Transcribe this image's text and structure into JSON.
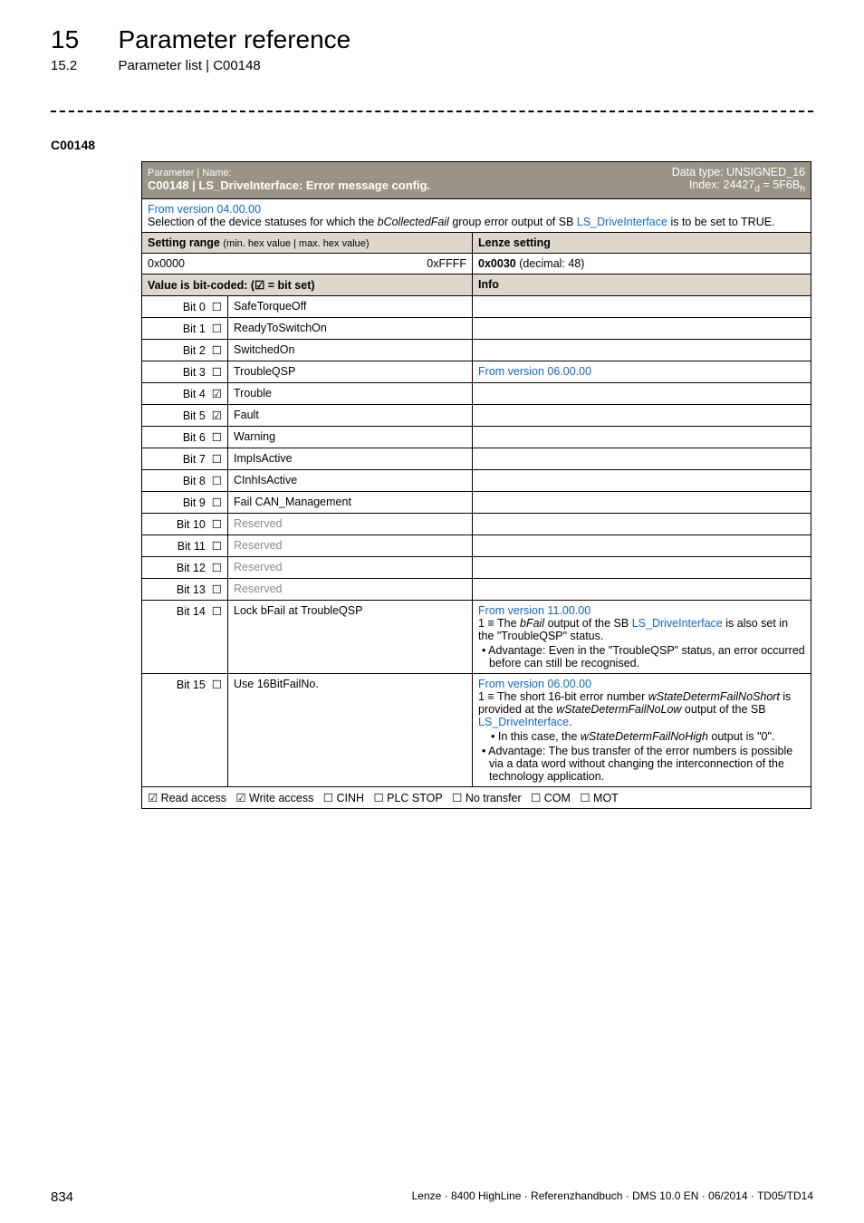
{
  "header": {
    "chapter_num": "15",
    "chapter_title": "Parameter reference",
    "section_num": "15.2",
    "section_title": "Parameter list | C00148"
  },
  "param_code": "C00148",
  "table": {
    "hdr_paramname_label": "Parameter | Name:",
    "hdr_paramname_value": "C00148 | LS_DriveInterface: Error message config.",
    "hdr_dtype": "Data type: UNSIGNED_16",
    "hdr_index": "Index: 24427",
    "hdr_index_d": "d",
    "hdr_index_eq": " = 5F6B",
    "hdr_index_h": "h",
    "desc_version": "From version 04.00.00",
    "desc_text_pre": "Selection of the device statuses for which the ",
    "desc_text_ital": "bCollectedFail",
    "desc_text_mid": " group error output of SB ",
    "desc_text_link": "LS_DriveInterface",
    "desc_text_post": " is to be set to TRUE.",
    "setting_range_label": "Setting range ",
    "setting_range_sub": "(min. hex value | max. hex value)",
    "lenze_setting_label": "Lenze setting",
    "min_hex": "0x0000",
    "max_hex": "0xFFFF",
    "default_hex": "0x0030",
    "default_dec": "  (decimal: 48)",
    "bitcoded_label_pre": "Value is bit-coded:  (",
    "bitcoded_label_post": " = bit set)",
    "info_label": "Info",
    "bits": [
      {
        "bit": "Bit 0",
        "chk": "☐",
        "name": "SafeTorqueOff",
        "info": ""
      },
      {
        "bit": "Bit 1",
        "chk": "☐",
        "name": "ReadyToSwitchOn",
        "info": ""
      },
      {
        "bit": "Bit 2",
        "chk": "☐",
        "name": "SwitchedOn",
        "info": ""
      },
      {
        "bit": "Bit 3",
        "chk": "☐",
        "name": "TroubleQSP",
        "info_link": "From version 06.00.00"
      },
      {
        "bit": "Bit 4",
        "chk": "☑",
        "name": "Trouble",
        "info": ""
      },
      {
        "bit": "Bit 5",
        "chk": "☑",
        "name": "Fault",
        "info": ""
      },
      {
        "bit": "Bit 6",
        "chk": "☐",
        "name": "Warning",
        "info": ""
      },
      {
        "bit": "Bit 7",
        "chk": "☐",
        "name": "ImpIsActive",
        "info": ""
      },
      {
        "bit": "Bit 8",
        "chk": "☐",
        "name": "CInhIsActive",
        "info": ""
      },
      {
        "bit": "Bit 9",
        "chk": "☐",
        "name": "Fail CAN_Management",
        "info": ""
      },
      {
        "bit": "Bit 10",
        "chk": "☐",
        "name": "Reserved",
        "grey": true,
        "info": ""
      },
      {
        "bit": "Bit 11",
        "chk": "☐",
        "name": "Reserved",
        "grey": true,
        "info": ""
      },
      {
        "bit": "Bit 12",
        "chk": "☐",
        "name": "Reserved",
        "grey": true,
        "info": ""
      },
      {
        "bit": "Bit 13",
        "chk": "☐",
        "name": "Reserved",
        "grey": true,
        "info": ""
      }
    ],
    "bit14": {
      "bit": "Bit 14",
      "chk": "☐",
      "name": "Lock bFail at TroubleQSP",
      "info_version": "From version 11.00.00",
      "info_line1_pre": "1 ≡ The ",
      "info_line1_ital": "bFail",
      "info_line1_mid": " output of the SB ",
      "info_line1_link": "LS_DriveInterface",
      "info_line1_post": " is also set in the \"TroubleQSP\" status.",
      "info_bullet": "• Advantage: Even in the \"TroubleQSP\" status, an error occurred before can still be recognised."
    },
    "bit15": {
      "bit": "Bit 15",
      "chk": "☐",
      "name": "Use 16BitFailNo.",
      "info_version": "From version 06.00.00",
      "info_l1": "1 ≡ The short 16-bit error number ",
      "info_l1_ital1": "wStateDetermFailNoShort",
      "info_l1_mid": " is provided at the ",
      "info_l1_ital2": "wStateDetermFailNoLow",
      "info_l1_post": " output of the SB ",
      "info_l1_link": "LS_DriveInterface",
      "info_l1_end": ".",
      "info_sub_bullet_pre": "• In this case, the ",
      "info_sub_bullet_ital": "wStateDetermFailNoHigh",
      "info_sub_bullet_post": " output is \"0\".",
      "info_bullet2": "• Advantage: The bus transfer of the error numbers is possible via a data word without changing the interconnection of the technology application."
    },
    "access": {
      "read": "☑ Read access",
      "write": "☑ Write access",
      "cinh": "☐ CINH",
      "plcstop": "☐ PLC STOP",
      "notransfer": "☐ No transfer",
      "com": "☐ COM",
      "mot": "☐ MOT"
    }
  },
  "footer": {
    "page": "834",
    "info": "Lenze · 8400 HighLine · Referenzhandbuch · DMS 10.0 EN · 06/2014 · TD05/TD14"
  }
}
